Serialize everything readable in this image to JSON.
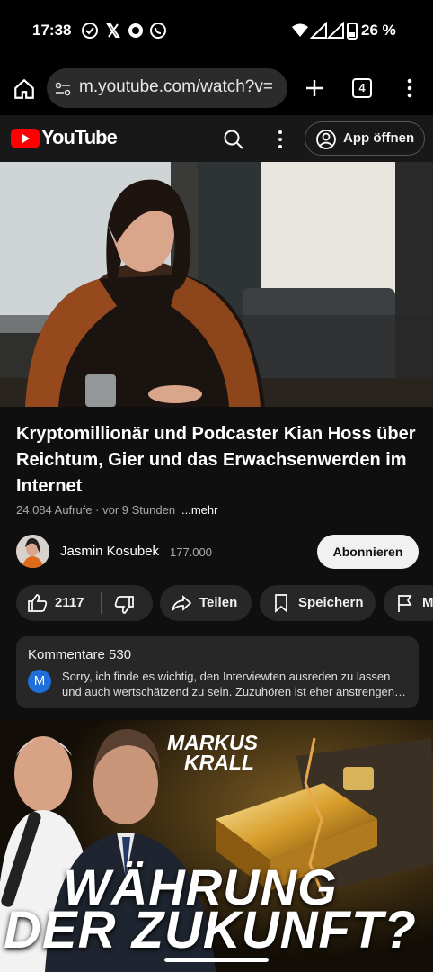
{
  "status_bar": {
    "time": "17:38",
    "battery": "26 %"
  },
  "browser": {
    "url": "m.youtube.com/watch?v=",
    "tab_count": "4"
  },
  "header": {
    "logo_text": "YouTube",
    "app_button": "App öffnen"
  },
  "video": {
    "title": "Kryptomillionär und Podcaster Kian Hoss über Reichtum, Gier und das Erwachsenwerden im Internet",
    "meta": "24.084 Aufrufe · vor 9 Stunden",
    "more": "...mehr"
  },
  "channel": {
    "name": "Jasmin Kosubek",
    "subscribers": "177.000",
    "subscribe_label": "Abonnieren"
  },
  "actions": {
    "likes": "2117",
    "share": "Teilen",
    "save": "Speichern",
    "report": "M"
  },
  "comments": {
    "header": "Kommentare 530",
    "avatar_letter": "M",
    "top_comment": "Sorry, ich finde es wichtig, den Interviewten ausreden zu lassen und auch wertschätzend zu sein. Zuzuhören ist eher anstrengen…"
  },
  "next_video": {
    "line1": "WÄHRUNG",
    "line2": "DER ZUKUNFT?",
    "name1": "MARKUS",
    "name2": "KRALL"
  },
  "colors": {
    "yt_red": "#ff0000",
    "background": "#0f0f0f",
    "pill": "#272727"
  }
}
